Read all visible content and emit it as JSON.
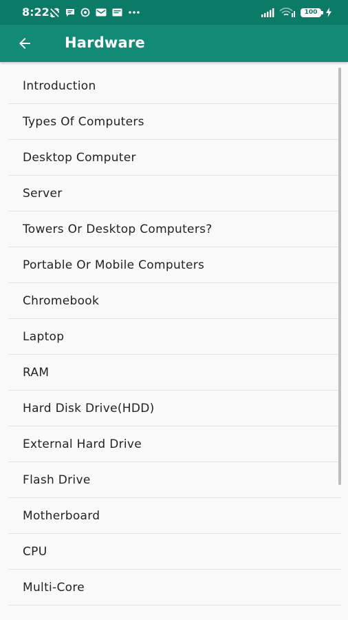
{
  "status_bar": {
    "time": "8:22",
    "battery_level": "100",
    "left_icons": [
      "sync-disabled-icon",
      "message-icon",
      "whatsapp-icon",
      "gmail-icon",
      "mail-icon",
      "more-icon"
    ],
    "right_icons": [
      "signal-icon",
      "wifi-icon",
      "battery-icon",
      "charging-icon"
    ]
  },
  "app_bar": {
    "title": "Hardware",
    "back_icon": "arrow-back-icon"
  },
  "list": {
    "items": [
      {
        "label": "Introduction"
      },
      {
        "label": "Types Of Computers"
      },
      {
        "label": "Desktop Computer"
      },
      {
        "label": "Server"
      },
      {
        "label": "Towers Or Desktop Computers?"
      },
      {
        "label": "Portable Or Mobile Computers"
      },
      {
        "label": "Chromebook"
      },
      {
        "label": "Laptop"
      },
      {
        "label": "RAM"
      },
      {
        "label": "Hard Disk Drive(HDD)"
      },
      {
        "label": "External Hard Drive"
      },
      {
        "label": "Flash Drive"
      },
      {
        "label": "Motherboard"
      },
      {
        "label": "CPU"
      },
      {
        "label": "Multi-Core"
      }
    ]
  },
  "colors": {
    "status_bar": "#0b7a66",
    "app_bar": "#138a76",
    "background": "#fafafa",
    "divider": "#e4e4e4",
    "text": "#222222"
  }
}
